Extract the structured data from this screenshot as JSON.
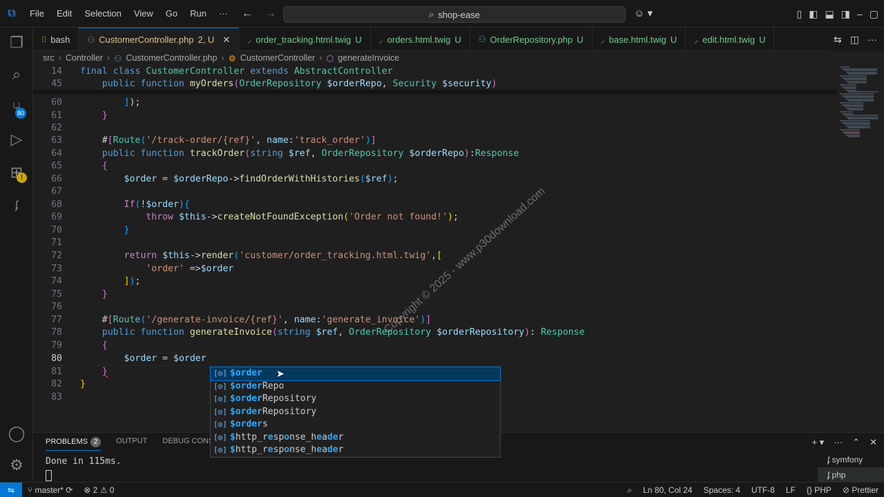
{
  "titlebar": {
    "menus": [
      "File",
      "Edit",
      "Selection",
      "View",
      "Go",
      "Run",
      "···"
    ],
    "search_text": "shop-ease"
  },
  "activity": {
    "scm_badge": "80",
    "warn_badge": "!"
  },
  "tabs": [
    {
      "label": "bash",
      "status": "",
      "icon": "terminal-icon",
      "color": "#cccccc"
    },
    {
      "label": "CustomerController.php",
      "status": "2, U",
      "icon": "php-file-icon",
      "color": "#e2c08d",
      "active": true
    },
    {
      "label": "order_tracking.html.twig",
      "status": "U",
      "icon": "twig-file-icon",
      "color": "#73c991"
    },
    {
      "label": "orders.html.twig",
      "status": "U",
      "icon": "twig-file-icon",
      "color": "#73c991"
    },
    {
      "label": "OrderRepository.php",
      "status": "U",
      "icon": "php-file-icon",
      "color": "#73c991"
    },
    {
      "label": "base.html.twig",
      "status": "U",
      "icon": "twig-file-icon",
      "color": "#73c991"
    },
    {
      "label": "edit.html.twig",
      "status": "U",
      "icon": "twig-file-icon",
      "color": "#73c991"
    }
  ],
  "breadcrumb": {
    "items": [
      "src",
      "Controller",
      "CustomerController.php",
      "CustomerController",
      "generateInvoice"
    ]
  },
  "code_lines": [
    {
      "n": "14",
      "html": "<span class='k'>final</span> <span class='k'>class</span> <span class='t'>CustomerController</span> <span class='k'>extends</span> <span class='t'>AbstractController</span>"
    },
    {
      "n": "45",
      "html": "    <span class='k'>public</span> <span class='k'>function</span> <span class='f'>myOrders</span><span class='b2'>(</span><span class='t'>OrderRepository</span> <span class='v'>$orderRepo</span>, <span class='t'>Security</span> <span class='v'>$security</span><span class='b2'>)</span>"
    },
    {
      "n": "60",
      "html": "        <span class='b3'>]</span>);"
    },
    {
      "n": "61",
      "html": "    <span class='b2'>}</span>"
    },
    {
      "n": "62",
      "html": ""
    },
    {
      "n": "63",
      "html": "    #<span class='b2'>[</span><span class='t'>Route</span><span class='b3'>(</span><span class='s'>'/track-order/{ref}'</span>, <span class='v'>name</span>:<span class='s'>'track_order'</span><span class='b3'>)</span><span class='b2'>]</span>"
    },
    {
      "n": "64",
      "html": "    <span class='k'>public</span> <span class='k'>function</span> <span class='f'>trackOrder</span><span class='b2'>(</span><span class='k'>string</span> <span class='v'>$ref</span>, <span class='t'>OrderRepository</span> <span class='v'>$orderRepo</span><span class='b2'>)</span>:<span class='t'>Response</span>"
    },
    {
      "n": "65",
      "html": "    <span class='b2'>{</span>"
    },
    {
      "n": "66",
      "html": "        <span class='v'>$order</span> = <span class='v'>$orderRepo</span>-><span class='f'>findOrderWithHistories</span><span class='b3'>(</span><span class='v'>$ref</span><span class='b3'>)</span>;"
    },
    {
      "n": "67",
      "html": ""
    },
    {
      "n": "68",
      "html": "        <span class='kw'>If</span><span class='b3'>(</span>!<span class='v'>$order</span><span class='b3'>)</span><span class='b3'>{</span>"
    },
    {
      "n": "69",
      "html": "            <span class='kw'>throw</span> <span class='v'>$this</span>-><span class='f'>createNotFoundException</span><span class='b1'>(</span><span class='s'>'Order not found!'</span><span class='b1'>)</span>;"
    },
    {
      "n": "70",
      "html": "        <span class='b3'>}</span>"
    },
    {
      "n": "71",
      "html": ""
    },
    {
      "n": "72",
      "html": "        <span class='kw'>return</span> <span class='v'>$this</span>-><span class='f'>render</span><span class='b3'>(</span><span class='s'>'customer/order_tracking.html.twig'</span>,<span class='b1'>[</span>"
    },
    {
      "n": "73",
      "html": "            <span class='s'>'order'</span> =><span class='v'>$order</span>"
    },
    {
      "n": "74",
      "html": "        <span class='b1'>]</span><span class='b3'>)</span>;"
    },
    {
      "n": "75",
      "html": "    <span class='b2'>}</span>"
    },
    {
      "n": "76",
      "html": ""
    },
    {
      "n": "77",
      "html": "    #<span class='b2'>[</span><span class='t'>Route</span><span class='b3'>(</span><span class='s'>'/generate-invoice/{ref}'</span>, <span class='v'>name</span>:<span class='s'>'generate_invoice'</span><span class='b3'>)</span><span class='b2'>]</span>"
    },
    {
      "n": "78",
      "html": "    <span class='k'>public</span> <span class='k'>function</span> <span class='f'>generateInvoice</span><span class='b2'>(</span><span class='k'>string</span> <span class='v'>$ref</span>, <span class='t'>OrderRepository</span> <span class='v'>$orderRepository</span><span class='b2'>)</span>: <span class='t'>Response</span>"
    },
    {
      "n": "79",
      "html": "    <span class='b2'>{</span>"
    },
    {
      "n": "80",
      "html": "        <span class='v'>$order</span> = <span class='v'>$order</span>"
    },
    {
      "n": "81",
      "html": "    <span class='b2 squig'>}</span>"
    },
    {
      "n": "82",
      "html": "<span class='b1'>}</span>"
    },
    {
      "n": "83",
      "html": ""
    }
  ],
  "watermark": "Copyright © 2025 - www.p30download.com",
  "suggestions": [
    {
      "match": "$order",
      "rest": "",
      "selected": true
    },
    {
      "match": "$order",
      "rest": "Repo"
    },
    {
      "match": "$order",
      "rest": "Repository"
    },
    {
      "match": "$order",
      "rest": "Repository"
    },
    {
      "match": "$order",
      "rest": "s"
    },
    {
      "match": "",
      "rest": "$http_response_header",
      "fuzzy": true
    },
    {
      "match": "",
      "rest": "$http_response_header",
      "fuzzy": true
    }
  ],
  "panel": {
    "tabs": [
      "PROBLEMS",
      "OUTPUT",
      "DEBUG CONSOLE"
    ],
    "problems_count": "2",
    "terminal_output": "Done in 115ms.",
    "terminals": [
      "symfony",
      "php"
    ]
  },
  "statusbar": {
    "branch": "master*",
    "errors": "2",
    "warnings": "0",
    "position": "Ln 80, Col 24",
    "spaces": "Spaces: 4",
    "encoding": "UTF-8",
    "eol": "LF",
    "language": "PHP",
    "formatter": "Prettier"
  }
}
